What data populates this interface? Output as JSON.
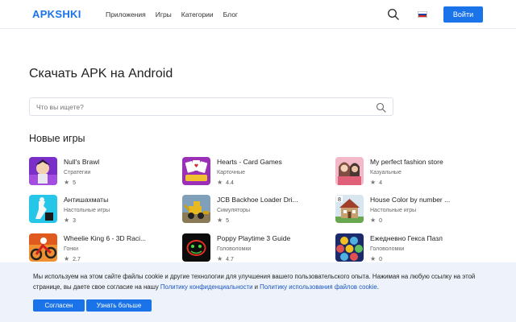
{
  "header": {
    "logo": "APKSHKI",
    "nav": [
      "Приложения",
      "Игры",
      "Категории",
      "Блог"
    ],
    "login_label": "Войти"
  },
  "main": {
    "title": "Скачать APK на Android",
    "search_placeholder": "Что вы ищете?",
    "section_title": "Новые игры"
  },
  "games": [
    {
      "name": "Null's Brawl",
      "category": "Стратегии",
      "rating": "5"
    },
    {
      "name": "Hearts - Card Games",
      "category": "Карточные",
      "rating": "4.4"
    },
    {
      "name": "My perfect fashion store",
      "category": "Казуальные",
      "rating": "4"
    },
    {
      "name": "Антишахматы",
      "category": "Настольные игры",
      "rating": "3"
    },
    {
      "name": "JCB Backhoe Loader Dri...",
      "category": "Симуляторы",
      "rating": "5"
    },
    {
      "name": "House Color by number ...",
      "category": "Настольные игры",
      "rating": "0"
    },
    {
      "name": "Wheelie King 6 - 3D Raci...",
      "category": "Гонки",
      "rating": "2.7"
    },
    {
      "name": "Poppy Playtime 3 Guide",
      "category": "Головоломки",
      "rating": "4.7"
    },
    {
      "name": "Ежедневно Гекса Пазл",
      "category": "Головоломки",
      "rating": "0"
    }
  ],
  "cookie": {
    "text": "Мы используем на этом сайте файлы cookie и другие технологии для улучшения вашего пользовательского опыта. Нажимая на любую ссылку на этой странице, вы даете свое согласие на нашу ",
    "link1": "Политику конфиденциальности",
    "and": " и ",
    "link2": "Политику использования файлов cookie",
    "end": ".",
    "agree_label": "Согласен",
    "more_label": "Узнать больше"
  },
  "colors": {
    "accent": "#1a73e8",
    "cookie_bg": "#eef3fb"
  }
}
